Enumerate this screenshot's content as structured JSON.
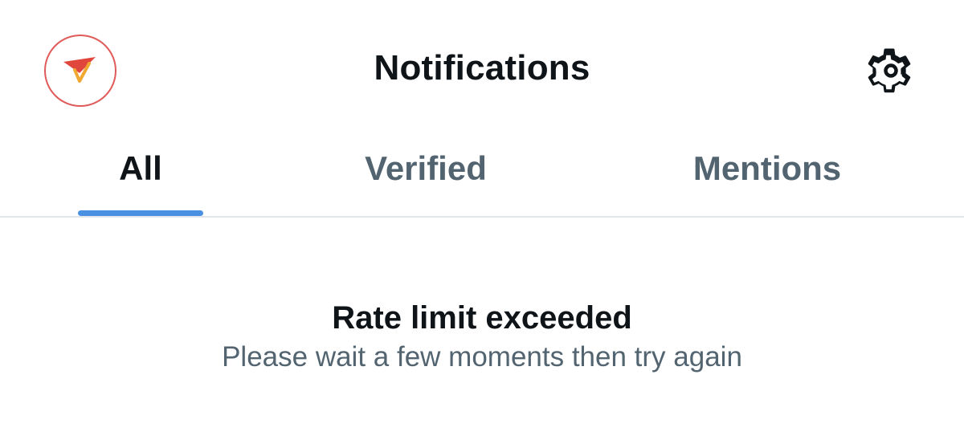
{
  "header": {
    "title": "Notifications",
    "avatar_icon": "paper-plane-check-logo",
    "settings_icon": "gear-icon"
  },
  "tabs": [
    {
      "label": "All",
      "active": true
    },
    {
      "label": "Verified",
      "active": false
    },
    {
      "label": "Mentions",
      "active": false
    }
  ],
  "message": {
    "title": "Rate limit exceeded",
    "subtitle": "Please wait a few moments then try again"
  },
  "colors": {
    "text_primary": "#0f1419",
    "text_secondary": "#536471",
    "accent": "#4a90e2",
    "divider": "#e1e6ea",
    "logo_red": "#e0463c",
    "logo_orange": "#f0a830"
  }
}
